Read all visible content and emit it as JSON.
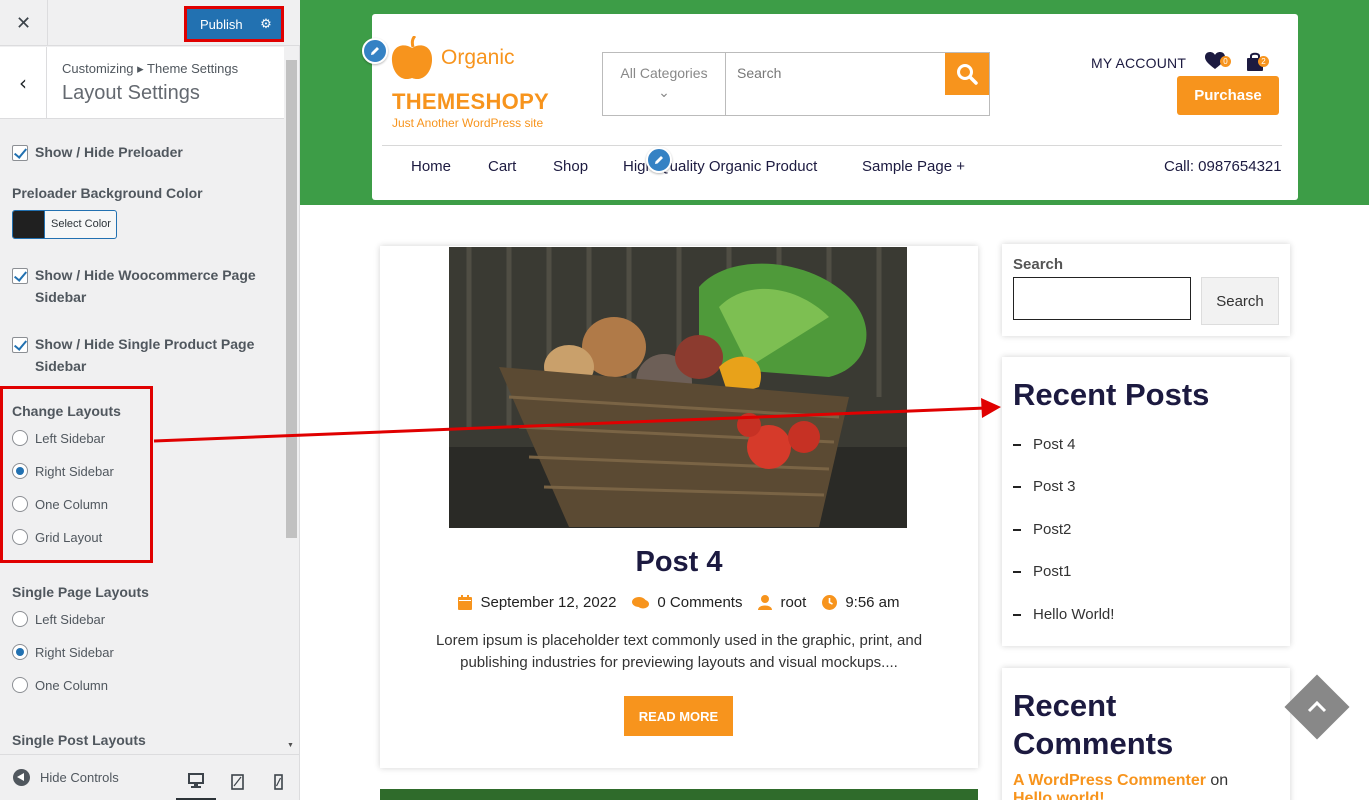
{
  "customizer": {
    "close_icon": "close-icon",
    "publish_label": "Publish",
    "breadcrumb": "Customizing ▸ Theme Settings",
    "section_title": "Layout Settings",
    "preloader_toggle": "Show / Hide Preloader",
    "preloader_bg_label": "Preloader Background Color",
    "preloader_bg_color": "#202020",
    "select_color_label": "Select Color",
    "woo_sidebar_toggle_1": "Show / Hide Woocommerce Page",
    "woo_sidebar_toggle_2": "Sidebar",
    "single_product_toggle_1": "Show / Hide Single Product Page",
    "single_product_toggle_2": "Sidebar",
    "change_layouts": {
      "title": "Change Layouts",
      "options": [
        "Left Sidebar",
        "Right Sidebar",
        "One Column",
        "Grid Layout"
      ],
      "selected": "Right Sidebar"
    },
    "single_page_layouts": {
      "title": "Single Page Layouts",
      "options": [
        "Left Sidebar",
        "Right Sidebar",
        "One Column"
      ],
      "selected": "Right Sidebar"
    },
    "single_post_layouts_title": "Single Post Layouts",
    "hide_controls_label": "Hide Controls",
    "devices": [
      "desktop-icon",
      "tablet-icon",
      "mobile-icon"
    ],
    "active_device": "desktop"
  },
  "site": {
    "logo_word": "Organic",
    "site_name": "THEMESHOPY",
    "tagline": "Just Another WordPress site",
    "category_placeholder": "All Categories",
    "search_placeholder": "Search",
    "my_account": "MY ACCOUNT",
    "wishlist_count": "0",
    "cart_count": "2",
    "purchase_label": "Purchase",
    "nav": [
      "Home",
      "Cart",
      "Shop",
      "High Quality Organic Product",
      "Sample Page +"
    ],
    "call": "Call: 0987654321",
    "accent_color": "#f7941d",
    "header_green": "#3d9d47",
    "navy": "#1c1a40"
  },
  "post": {
    "title": "Post 4",
    "date": "September 12, 2022",
    "comments": "0 Comments",
    "author": "root",
    "time": "9:56 am",
    "excerpt_1": "Lorem ipsum is placeholder text commonly used in the graphic, print, and",
    "excerpt_2": "publishing industries for previewing layouts and visual mockups....",
    "read_more": "READ MORE"
  },
  "sidebar": {
    "search_label": "Search",
    "search_button": "Search",
    "recent_posts_title": "Recent Posts",
    "recent_posts": [
      "Post 4",
      "Post 3",
      "Post2",
      "Post1",
      "Hello World!"
    ],
    "recent_comments_title_1": "Recent",
    "recent_comments_title_2": "Comments",
    "comment_author": "A WordPress Commenter",
    "comment_on": "on",
    "comment_post": "Hello world!"
  }
}
